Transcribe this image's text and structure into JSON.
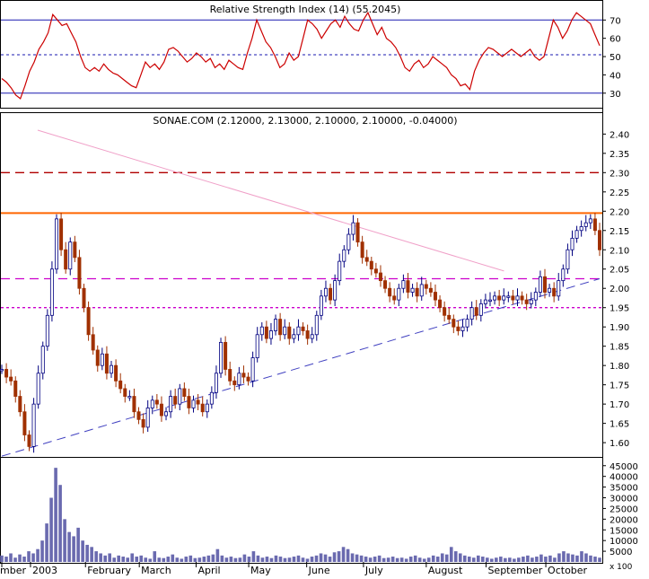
{
  "chart_data": [
    {
      "panel": "rsi",
      "type": "line",
      "title": "Relative Strength Index (14) (55.2045)",
      "y_ticks": [
        30,
        40,
        50,
        60,
        70
      ],
      "ylim": [
        24,
        78
      ],
      "reference_lines": [
        {
          "value": 70,
          "color": "#1a1ab0",
          "style": "solid"
        },
        {
          "value": 30,
          "color": "#1a1ab0",
          "style": "solid"
        },
        {
          "value": 51,
          "color": "#1a1ab0",
          "style": "dashed"
        }
      ],
      "series": [
        {
          "color": "#cc0000",
          "values": [
            38,
            36,
            33,
            29,
            27,
            34,
            42,
            47,
            54,
            58,
            63,
            73,
            70,
            67,
            68,
            63,
            58,
            50,
            44,
            42,
            44,
            42,
            46,
            43,
            41,
            40,
            38,
            36,
            34,
            33,
            40,
            47,
            44,
            46,
            43,
            47,
            54,
            55,
            53,
            50,
            47,
            49,
            52,
            50,
            47,
            49,
            44,
            46,
            43,
            48,
            46,
            44,
            43,
            52,
            60,
            70,
            64,
            58,
            55,
            50,
            44,
            46,
            52,
            48,
            50,
            60,
            70,
            68,
            65,
            60,
            64,
            68,
            70,
            66,
            72,
            68,
            65,
            64,
            70,
            74,
            68,
            62,
            66,
            60,
            58,
            55,
            50,
            44,
            42,
            46,
            48,
            44,
            46,
            50,
            48,
            46,
            44,
            40,
            38,
            34,
            35,
            32,
            42,
            48,
            52,
            55,
            54,
            52,
            50,
            52,
            54,
            52,
            50,
            52,
            54,
            50,
            48,
            50,
            60,
            70,
            66,
            60,
            64,
            70,
            74,
            72,
            70,
            68,
            62,
            56
          ]
        }
      ]
    },
    {
      "panel": "price",
      "type": "bar",
      "title": "SONAE.COM (2.12000, 2.13000, 2.10000, 2.10000, -0.04000)",
      "y_ticks": [
        1.6,
        1.65,
        1.7,
        1.75,
        1.8,
        1.85,
        1.9,
        1.95,
        2.0,
        2.05,
        2.1,
        2.15,
        2.2,
        2.25,
        2.3,
        2.35,
        2.4
      ],
      "ylim": [
        1.57,
        2.445
      ],
      "close": [
        1.79,
        1.77,
        1.76,
        1.72,
        1.68,
        1.62,
        1.59,
        1.7,
        1.78,
        1.85,
        1.93,
        2.05,
        2.18,
        2.1,
        2.05,
        2.12,
        2.08,
        2.0,
        1.95,
        1.88,
        1.84,
        1.8,
        1.83,
        1.78,
        1.8,
        1.76,
        1.74,
        1.72,
        1.72,
        1.68,
        1.66,
        1.64,
        1.69,
        1.71,
        1.7,
        1.67,
        1.68,
        1.72,
        1.7,
        1.74,
        1.72,
        1.69,
        1.71,
        1.7,
        1.68,
        1.7,
        1.73,
        1.78,
        1.86,
        1.79,
        1.76,
        1.75,
        1.78,
        1.77,
        1.76,
        1.82,
        1.88,
        1.9,
        1.87,
        1.89,
        1.92,
        1.88,
        1.9,
        1.87,
        1.88,
        1.9,
        1.89,
        1.87,
        1.88,
        1.93,
        1.98,
        2.0,
        1.97,
        2.02,
        2.07,
        2.1,
        2.14,
        2.17,
        2.12,
        2.08,
        2.07,
        2.05,
        2.04,
        2.02,
        2.0,
        1.98,
        1.97,
        2.0,
        2.02,
        1.99,
        2.0,
        1.98,
        2.01,
        2.0,
        1.99,
        1.97,
        1.95,
        1.93,
        1.92,
        1.9,
        1.89,
        1.9,
        1.92,
        1.95,
        1.93,
        1.96,
        1.97,
        1.97,
        1.98,
        1.97,
        1.98,
        1.98,
        1.97,
        1.98,
        1.97,
        1.96,
        1.97,
        1.99,
        2.03,
        1.99,
        2.0,
        1.98,
        2.02,
        2.05,
        2.1,
        2.13,
        2.15,
        2.16,
        2.17,
        2.18,
        2.15,
        2.1
      ],
      "reference_lines": [
        {
          "value": 2.195,
          "color": "#ff6600",
          "style": "solid"
        },
        {
          "value": 2.3,
          "color": "#b00000",
          "style": "dashed"
        },
        {
          "value": 2.025,
          "color": "#cc00cc",
          "style": "dashed"
        },
        {
          "value": 1.95,
          "color": "#cc00cc",
          "style": "dotted"
        }
      ],
      "trendlines": [
        {
          "from": [
            0.0,
            1.565
          ],
          "to": [
            1.0,
            2.025
          ],
          "color": "#4040c0",
          "style": "dashed"
        },
        {
          "from": [
            0.06,
            2.41
          ],
          "to": [
            0.84,
            2.045
          ],
          "color": "#f0a0c8",
          "style": "solid"
        }
      ]
    },
    {
      "panel": "volume",
      "type": "bar",
      "y_ticks": [
        5000,
        10000,
        15000,
        20000,
        25000,
        30000,
        35000,
        40000,
        45000
      ],
      "y_tick_labels": [
        "5000",
        "10000",
        "15000",
        "20000",
        "25000",
        "30000",
        "35000",
        "40000",
        "45000"
      ],
      "bottom_label": "x 100",
      "ylim": [
        0,
        47000
      ],
      "values": [
        3000,
        2500,
        4000,
        2000,
        3500,
        2500,
        5000,
        4000,
        6000,
        10000,
        18000,
        30000,
        44000,
        36000,
        20000,
        14000,
        12000,
        16000,
        10000,
        8000,
        7000,
        5000,
        4000,
        3000,
        4000,
        2000,
        3000,
        2500,
        2000,
        4000,
        2500,
        3000,
        2000,
        1500,
        5000,
        2000,
        1800,
        2500,
        3500,
        2000,
        1500,
        2500,
        3000,
        1800,
        2000,
        2500,
        3000,
        3500,
        6000,
        3000,
        2000,
        2500,
        1800,
        2000,
        3500,
        2500,
        5000,
        3000,
        2000,
        2500,
        1800,
        3000,
        2500,
        1800,
        2000,
        2500,
        3000,
        2000,
        1500,
        2500,
        3000,
        4000,
        3500,
        2500,
        4500,
        5000,
        7000,
        6000,
        4000,
        3500,
        3000,
        2500,
        2000,
        2500,
        3000,
        1800,
        2000,
        2500,
        1800,
        2000,
        1500,
        2500,
        3000,
        2000,
        1500,
        2000,
        3000,
        2500,
        4000,
        3500,
        7000,
        5000,
        4000,
        3000,
        2500,
        2000,
        3000,
        2500,
        2000,
        1500,
        2000,
        2500,
        1800,
        2000,
        1500,
        2000,
        2500,
        3000,
        2000,
        2500,
        3500,
        2500,
        3000,
        2000,
        4000,
        5000,
        4000,
        3500,
        3000,
        5000,
        4000,
        3000,
        2500,
        2000
      ]
    }
  ],
  "x_axis": {
    "labels": [
      "mber",
      "2003",
      "February",
      "March",
      "April",
      "May",
      "June",
      "July",
      "August",
      "September",
      "October"
    ],
    "positions": [
      0,
      0.048,
      0.14,
      0.23,
      0.325,
      0.413,
      0.51,
      0.605,
      0.71,
      0.81,
      0.91
    ]
  },
  "colors": {
    "up_bar": "#000080",
    "down_bar": "#a03000",
    "volume_bar": "#6a6aaf",
    "grid": "#000000",
    "rsi_line": "#cc0000"
  }
}
